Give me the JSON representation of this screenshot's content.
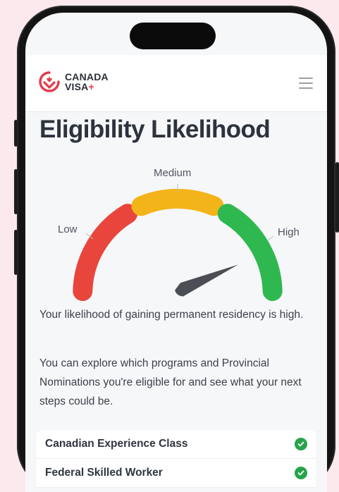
{
  "app": {
    "logo_line1": "CANADA",
    "logo_line2": "VISA",
    "logo_plus": "+"
  },
  "page": {
    "title": "Eligibility Likelihood"
  },
  "gauge": {
    "low_label": "Low",
    "medium_label": "Medium",
    "high_label": "High",
    "level": "High",
    "colors": {
      "low": "#e8453c",
      "medium": "#f2b418",
      "high": "#2eb84f",
      "needle": "#4b4f55"
    }
  },
  "result": {
    "likelihood_text": "Your likelihood of gaining permanent residency is high.",
    "explore_text": "You can explore which programs and Provincial Nominations you're eligible for and see what your next steps could be."
  },
  "programs": [
    {
      "name": "Canadian Experience Class",
      "eligible": true
    },
    {
      "name": "Federal Skilled Worker",
      "eligible": true
    }
  ],
  "icons": [
    "canada-visa-logo-icon",
    "menu-icon",
    "check-icon"
  ]
}
